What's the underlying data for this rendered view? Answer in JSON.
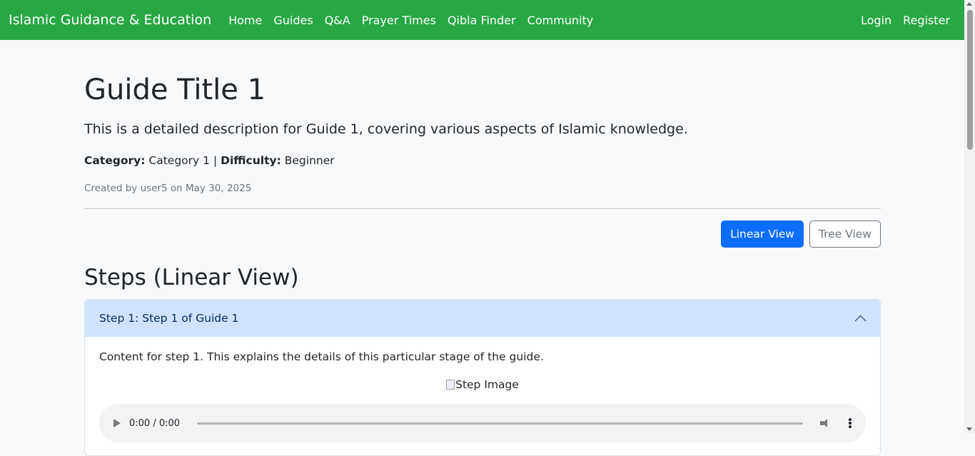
{
  "navbar": {
    "brand": "Islamic Guidance & Education",
    "links": [
      "Home",
      "Guides",
      "Q&A",
      "Prayer Times",
      "Qibla Finder",
      "Community"
    ],
    "login": "Login",
    "register": "Register",
    "color": "#28a745"
  },
  "guide": {
    "title": "Guide Title 1",
    "description": "This is a detailed description for Guide 1, covering various aspects of Islamic knowledge.",
    "category_label": "Category:",
    "category_value": "Category 1",
    "separator": "|",
    "difficulty_label": "Difficulty:",
    "difficulty_value": "Beginner",
    "created": "Created by user5 on May 30, 2025"
  },
  "view_toggle": {
    "linear": "Linear View",
    "tree": "Tree View",
    "active": "linear"
  },
  "steps": {
    "heading": "Steps (Linear View)",
    "items": [
      {
        "header": "Step 1: Step 1 of Guide 1",
        "expanded": true,
        "content": "Content for step 1. This explains the details of this particular stage of the guide.",
        "image_alt": "Step Image",
        "audio_time": "0:00 / 0:00"
      }
    ]
  }
}
